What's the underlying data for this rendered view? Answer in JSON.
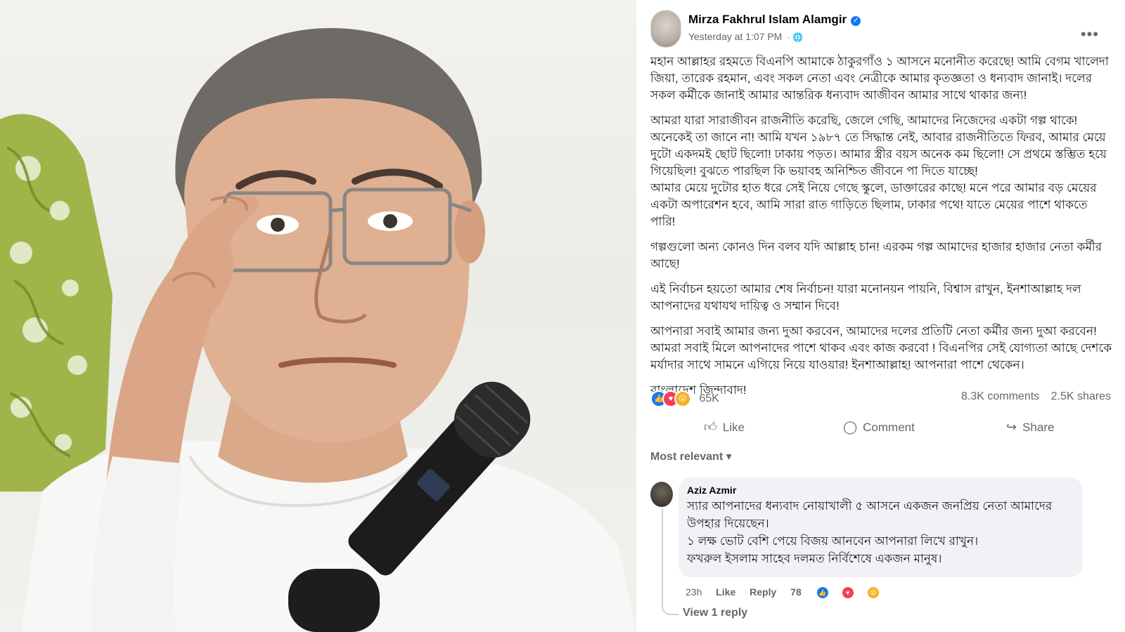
{
  "post": {
    "author": "Mirza Fakhrul Islam Alamgir",
    "time": "Yesterday at 1:07 PM",
    "paragraphs": [
      "মহান আল্লাহর রহমতে বিএনপি আমাকে ঠাকুরগাঁও ১ আসনে মনোনীত করেছে! আমি বেগম খালেদা জিয়া, তারেক রহমান, এবং সকল নেতা এবং নেত্রীকে আমার কৃতজ্ঞতা ও ধন্যবাদ জানাই। দলের সকল কর্মীকে জানাই আমার আন্তরিক ধন্যবাদ আজীবন আমার সাথে থাকার জন্য!",
      "আমরা যারা সারাজীবন রাজনীতি করেছি, জেলে গেছি, আমাদের নিজেদের একটা গল্প থাকে! অনেকেই তা জানে না! আমি যখন ১৯৮৭ তে সিদ্ধান্ত নেই, আবার রাজনীতিতে ফিরব, আমার মেয়ে দুটো একদমই ছোট ছিলো! ঢাকায় পড়ত। আমার স্ত্রীর বয়স অনেক কম ছিলো! সে প্রথমে স্তম্ভিত হয়ে গিয়েছিল! বুঝতে পারছিল কি ভয়াবহ অনিশ্চিত জীবনে পা দিতে যাচ্ছে!",
      "আমার মেয়ে দুটোর হাত ধরে সেই নিয়ে গেছে স্কুলে, ডাক্তারের কাছে! মনে পরে আমার বড় মেয়ের একটা অপারেশন হবে, আমি সারা রাত গাড়িতে ছিলাম, ঢাকার পথে! যাতে মেয়ের পাশে থাকতে পারি!",
      "গল্পগুলো অন্য কোনও দিন বলব যদি আল্লাহ চান! এরকম গল্প আমাদের হাজার হাজার নেতা কর্মীর আছে!",
      "এই নির্বাচন হয়তো আমার শেষ নির্বাচন!  যারা মনোনয়ন পায়নি, বিশ্বাস রাখুন, ইনশাআল্লাহ দল আপনাদের যথাযথ দায়িত্ব ও সম্মান দিবে!",
      "আপনারা সবাই আমার জন্য দুআ করবেন, আমাদের দলের প্রতিটি নেতা কর্মীর জন্য দুআ করবেন! আমরা সবাই মিলে আপনাদের পাশে থাকব এবং কাজ করবো ! বিএনপির সেই যোগ্যতা আছে দেশকে মর্যাদার সাথে সামনে এগিয়ে নিয়ে যাওয়ার! ইনশাআল্লাহ!  আপনারা পাশে থেকেন।",
      "বাংলাদেশ জিন্দাবাদ!"
    ],
    "reaction_count": "65K",
    "comments": "8.3K comments",
    "shares": "2.5K shares",
    "actions": {
      "like": "Like",
      "comment": "Comment",
      "share": "Share"
    },
    "sort_label": "Most relevant"
  },
  "comment": {
    "name": "Aziz Azmir",
    "lines": [
      "স্যার আপনাদের ধন্যবাদ নোয়াখালী ৫ আসনে একজন জনপ্রিয় নেতা আমাদের উপহার দিয়েছেন।",
      "১ লক্ষ ভোট বেশি পেয়ে বিজয় আনবেন আপনারা লিখে রাখুন।",
      "ফখরুল ইসলাম সাহেব দলমত নির্বিশেষে একজন মানুষ।"
    ],
    "age": "23h",
    "like": "Like",
    "reply": "Reply",
    "reactions": "78",
    "view_replies": "View 1 reply"
  },
  "colors": {
    "accent": "#1877f2",
    "meta": "#65676b",
    "bubble": "#f0f2f5"
  },
  "icons": [
    "verified-badge-icon",
    "globe-icon",
    "more-options-icon",
    "like-icon",
    "comment-icon",
    "share-icon",
    "chevron-down-icon",
    "love-icon",
    "wow-icon"
  ]
}
